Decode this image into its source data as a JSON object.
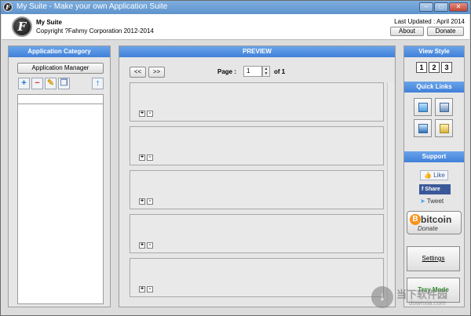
{
  "window": {
    "title": "My Suite - Make your own Application Suite",
    "icon_letter": "F",
    "minimize_glyph": "–",
    "maximize_glyph": "□",
    "close_glyph": "✕"
  },
  "header": {
    "logo_letter": "F",
    "app_name": "My Suite",
    "copyright": "Copyright ?Fahmy Corporation 2012-2014",
    "last_updated": "Last Updated : April 2014",
    "about_label": "About",
    "donate_label": "Donate"
  },
  "left_panel": {
    "title": "Application Category",
    "manager_label": "Application Manager",
    "tools": [
      {
        "icon": "add-icon",
        "glyph": "+",
        "color": "#1e73d2"
      },
      {
        "icon": "remove-icon",
        "glyph": "−",
        "color": "#d83a2a"
      },
      {
        "icon": "edit-icon",
        "glyph": "✎",
        "color": "#d8a21e"
      },
      {
        "icon": "copy-icon",
        "glyph": "❐",
        "color": "#5a7fa8"
      }
    ],
    "up_glyph": "↑",
    "categories": []
  },
  "preview": {
    "title": "PREVIEW",
    "prev_label": "<<",
    "next_label": ">>",
    "page_label": "Page :",
    "page_value": "1",
    "page_total": "of 1",
    "spin_up": "▲",
    "spin_down": "▼",
    "slots": 5,
    "plus_glyph": "+",
    "minus_glyph": "-"
  },
  "view_style": {
    "title": "View Style",
    "options": [
      "1",
      "2",
      "3"
    ]
  },
  "quick_links": {
    "title": "Quick Links",
    "items": [
      "computer-icon",
      "network-icon",
      "display-icon",
      "folder-icon"
    ]
  },
  "support": {
    "title": "Support",
    "like_label": "Like",
    "share_label": "Share",
    "tweet_label": "Tweet",
    "bitcoin_label": "bitcoin",
    "bitcoin_donate": "Donate"
  },
  "buttons": {
    "settings_label": "Settings",
    "tray_label": "Tray Mode"
  },
  "watermark": {
    "text": "当下软件园",
    "sub": "downxia.com"
  },
  "colors": {
    "accent": "#4a8ae0",
    "window_bg": "#dcdcdc",
    "tray_text": "#2f8b2f"
  }
}
